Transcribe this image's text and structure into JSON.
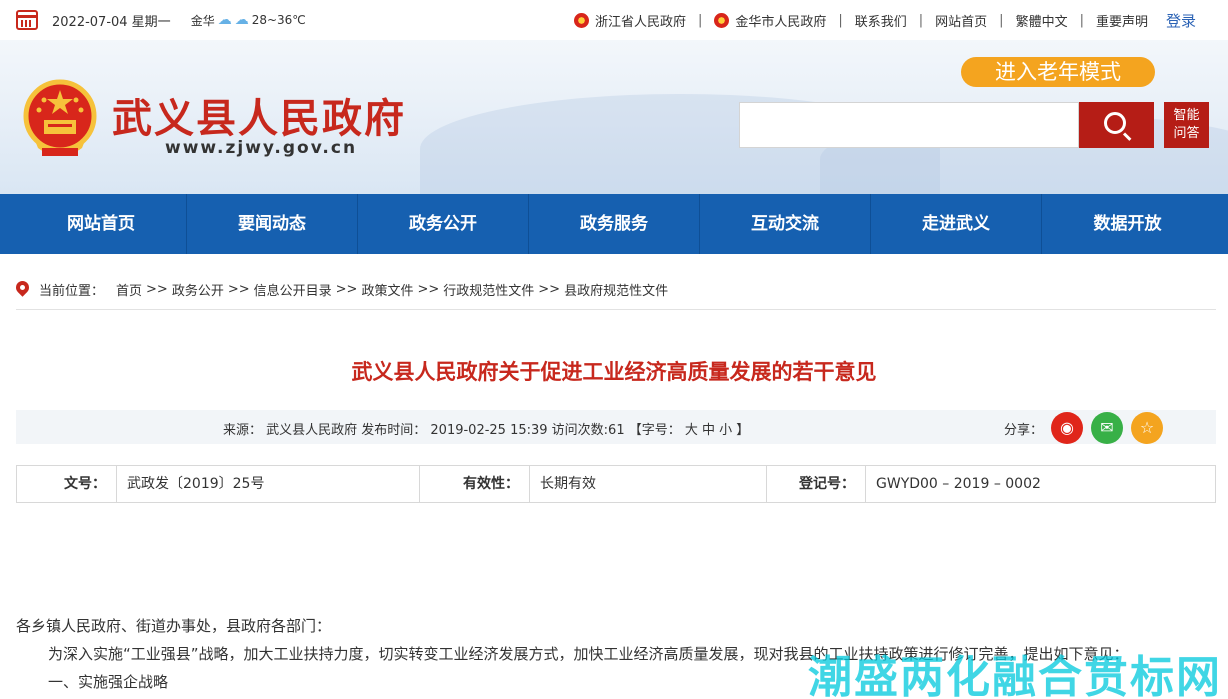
{
  "topbar": {
    "date": "2022-07-04 星期一",
    "city": "金华",
    "temperature": "28~36℃",
    "links": [
      "浙江省人民政府",
      "金华市人民政府",
      "联系我们",
      "网站首页",
      "繁體中文",
      "重要声明"
    ],
    "login": "登录"
  },
  "header": {
    "site_title": "武义县人民政府",
    "site_url": "www.zjwy.gov.cn",
    "elder_mode": "进入老年模式",
    "search_placeholder": "",
    "smart_qa_line1": "智能",
    "smart_qa_line2": "问答"
  },
  "nav": [
    "网站首页",
    "要闻动态",
    "政务公开",
    "政务服务",
    "互动交流",
    "走进武义",
    "数据开放"
  ],
  "breadcrumb": {
    "label": "当前位置：",
    "items": [
      "首页",
      "政务公开",
      "信息公开目录",
      "政策文件",
      "行政规范性文件",
      "县政府规范性文件"
    ],
    "sep": ">>"
  },
  "article": {
    "title": "武义县人民政府关于促进工业经济高质量发展的若干意见",
    "meta": "来源：  武义县人民政府 发布时间：  2019-02-25 15:39        访问次数:61 【字号：  大 中 小 】",
    "share_label": "分享：",
    "props": {
      "doc_no_label": "文号：",
      "doc_no": "武政发〔2019〕25号",
      "validity_label": "有效性：",
      "validity": "长期有效",
      "reg_label": "登记号：",
      "reg_no": "GWYD00 – 2019 – 0002"
    },
    "paragraphs": [
      "各乡镇人民政府、街道办事处，县政府各部门：",
      "为深入实施“工业强县”战略，加大工业扶持力度，切实转变工业经济发展方式，加快工业经济高质量发展，现对我县的工业扶持政策进行修订完善，提出如下意见：",
      "一、实施强企战略"
    ]
  },
  "watermark": "潮盛两化融合贯标网",
  "colors": {
    "brand_red": "#c7281d",
    "nav_blue": "#1660b0",
    "accent_orange": "#f4a41f"
  }
}
